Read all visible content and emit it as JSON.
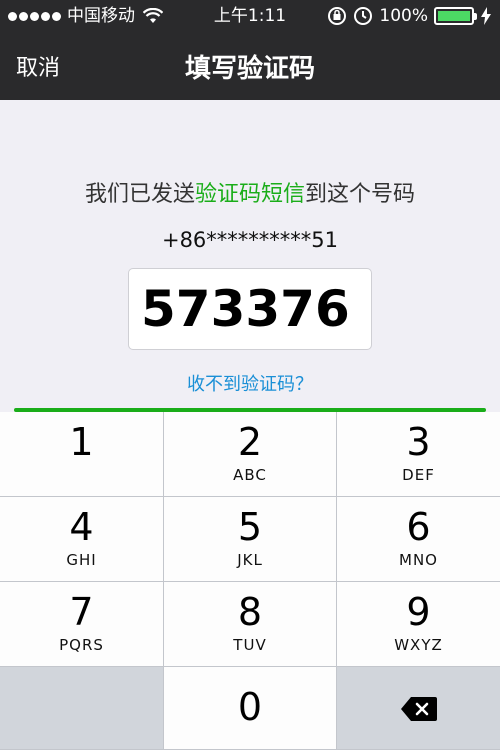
{
  "status_bar": {
    "carrier": "中国移动",
    "time": "上午1:11",
    "battery_percent": "100%"
  },
  "nav": {
    "cancel_label": "取消",
    "title": "填写验证码"
  },
  "content": {
    "prompt_before": "我们已发送",
    "prompt_highlight": "验证码短信",
    "prompt_after": "到这个号码",
    "phone_number": "+86**********51",
    "code_value": "573376",
    "resend_link": "收不到验证码？"
  },
  "keypad": {
    "keys": [
      {
        "num": "1",
        "letters": ""
      },
      {
        "num": "2",
        "letters": "ABC"
      },
      {
        "num": "3",
        "letters": "DEF"
      },
      {
        "num": "4",
        "letters": "GHI"
      },
      {
        "num": "5",
        "letters": "JKL"
      },
      {
        "num": "6",
        "letters": "MNO"
      },
      {
        "num": "7",
        "letters": "PQRS"
      },
      {
        "num": "8",
        "letters": "TUV"
      },
      {
        "num": "9",
        "letters": "WXYZ"
      },
      {
        "num": "0",
        "letters": ""
      }
    ],
    "delete_icon": "backspace-icon"
  },
  "colors": {
    "accent_green": "#1aad19",
    "link_blue": "#1a8fd6",
    "nav_bg": "#2a2a2c"
  }
}
